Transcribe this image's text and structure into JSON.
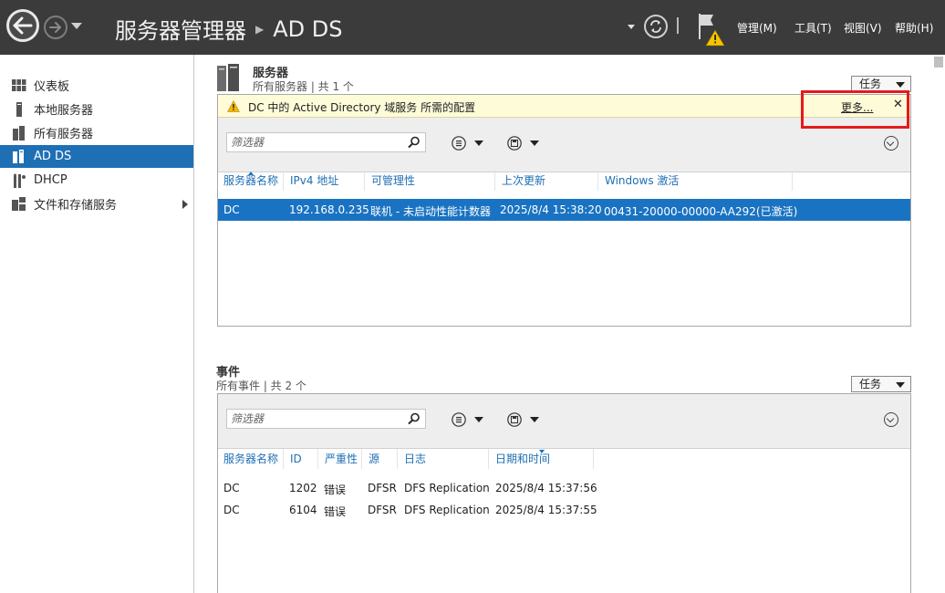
{
  "titlebar": {
    "app_title": "服务器管理器",
    "current_page": "AD DS",
    "menu": {
      "manage": "管理(M)",
      "tools": "工具(T)",
      "view": "视图(V)",
      "help": "帮助(H)"
    }
  },
  "sidebar": {
    "items": [
      {
        "label": "仪表板",
        "icon": "dashboard-icon"
      },
      {
        "label": "本地服务器",
        "icon": "local-server-icon"
      },
      {
        "label": "所有服务器",
        "icon": "all-servers-icon"
      },
      {
        "label": "AD DS",
        "icon": "ad-ds-icon"
      },
      {
        "label": "DHCP",
        "icon": "dhcp-icon"
      },
      {
        "label": "文件和存储服务",
        "icon": "file-storage-icon"
      }
    ]
  },
  "servers": {
    "title": "服务器",
    "subtitle": "所有服务器 | 共 1 个",
    "tasks_label": "任务",
    "notice": {
      "text": "DC 中的 Active Directory 域服务 所需的配置",
      "more": "更多...",
      "close": "✕"
    },
    "filter_placeholder": "筛选器",
    "columns": [
      "服务器名称",
      "IPv4 地址",
      "可管理性",
      "上次更新",
      "Windows 激活"
    ],
    "rows": [
      {
        "name": "DC",
        "ip": "192.168.0.235",
        "manageability": "联机 - 未启动性能计数器",
        "last_update": "2025/8/4 15:38:20",
        "activation": "00431-20000-00000-AA292(已激活)"
      }
    ]
  },
  "events": {
    "title": "事件",
    "subtitle": "所有事件 | 共 2 个",
    "tasks_label": "任务",
    "filter_placeholder": "筛选器",
    "columns": [
      "服务器名称",
      "ID",
      "严重性",
      "源",
      "日志",
      "日期和时间"
    ],
    "rows": [
      {
        "name": "DC",
        "id": "1202",
        "severity": "错误",
        "source": "DFSR",
        "log": "DFS Replication",
        "datetime": "2025/8/4 15:37:56"
      },
      {
        "name": "DC",
        "id": "6104",
        "severity": "错误",
        "source": "DFSR",
        "log": "DFS Replication",
        "datetime": "2025/8/4 15:37:55"
      }
    ]
  },
  "colors": {
    "titlebar": "#3b3b3b",
    "accent": "#1f6fb5",
    "selected_row": "#1a73c2",
    "notice_bg": "#fefbd9",
    "highlight_box": "#e31b1b"
  }
}
